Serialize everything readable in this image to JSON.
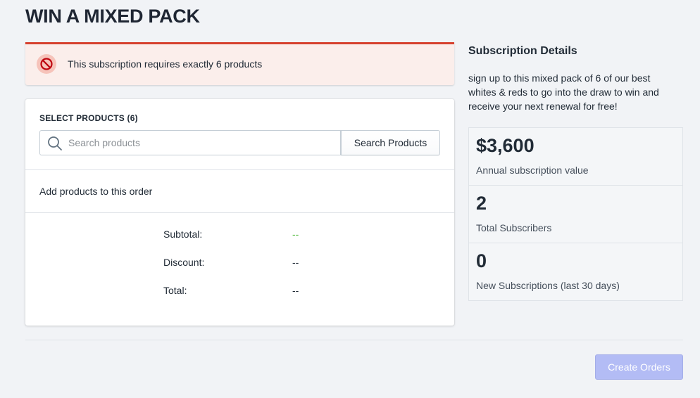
{
  "page": {
    "title": "WIN A MIXED PACK"
  },
  "alert": {
    "icon": "prohibited-icon",
    "message": "This subscription requires exactly 6 products",
    "color": "#d6402e"
  },
  "products": {
    "section_label": "SELECT PRODUCTS (6)",
    "search": {
      "placeholder": "Search products",
      "value": "",
      "icon": "search-icon"
    },
    "search_button_label": "Search Products",
    "empty_message": "Add products to this order"
  },
  "totals": {
    "rows": [
      {
        "label": "Subtotal:",
        "value": "--"
      },
      {
        "label": "Discount:",
        "value": "--"
      },
      {
        "label": "Total:",
        "value": "--"
      }
    ]
  },
  "details": {
    "title": "Subscription Details",
    "description": "sign up to this mixed pack of 6 of our best whites & reds to go into the draw to win and receive your next renewal for free!",
    "stats": [
      {
        "value": "$3,600",
        "label": "Annual subscription value"
      },
      {
        "value": "2",
        "label": "Total Subscribers"
      },
      {
        "value": "0",
        "label": "New Subscriptions (last 30 days)"
      }
    ]
  },
  "footer": {
    "create_button_label": "Create Orders",
    "create_button_color": "#b3bcf5"
  }
}
